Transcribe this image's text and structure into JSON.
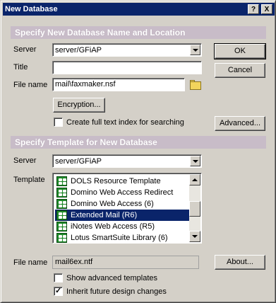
{
  "window": {
    "title": "New Database",
    "help_label": "?",
    "close_label": "X"
  },
  "section1": {
    "heading": "Specify New Database Name and Location",
    "server_label": "Server",
    "server_value": "server/GFiAP",
    "title_label": "Title",
    "title_value": "",
    "filename_label": "File name",
    "filename_value": "mail\\faxmaker.nsf",
    "encryption_label": "Encryption...",
    "fulltext_label": "Create full text index for searching",
    "fulltext_checked": false
  },
  "buttons": {
    "ok": "OK",
    "cancel": "Cancel",
    "advanced": "Advanced...",
    "about": "About..."
  },
  "section2": {
    "heading": "Specify Template for New Database",
    "server_label": "Server",
    "server_value": "server/GFiAP",
    "template_label": "Template",
    "templates": [
      "DOLS Resource Template",
      "Domino Web Access Redirect",
      "Domino Web Access (6)",
      "Extended Mail (R6)",
      "iNotes Web Access (R5)",
      "Lotus SmartSuite Library (6)"
    ],
    "selected_template": "Extended Mail (R6)",
    "filename_label": "File name",
    "filename_value": "mail6ex.ntf",
    "show_advanced_label": "Show advanced templates",
    "show_advanced_checked": false,
    "inherit_label": "Inherit future design changes",
    "inherit_checked": true
  },
  "colors": {
    "titlebar": "#0a246a",
    "section_header": "#c8bcc8",
    "selection": "#0a246a",
    "face": "#d4d0c8"
  },
  "icons": {
    "template_item": "database-icon",
    "browse": "folder-icon",
    "check": "checkmark-icon"
  }
}
